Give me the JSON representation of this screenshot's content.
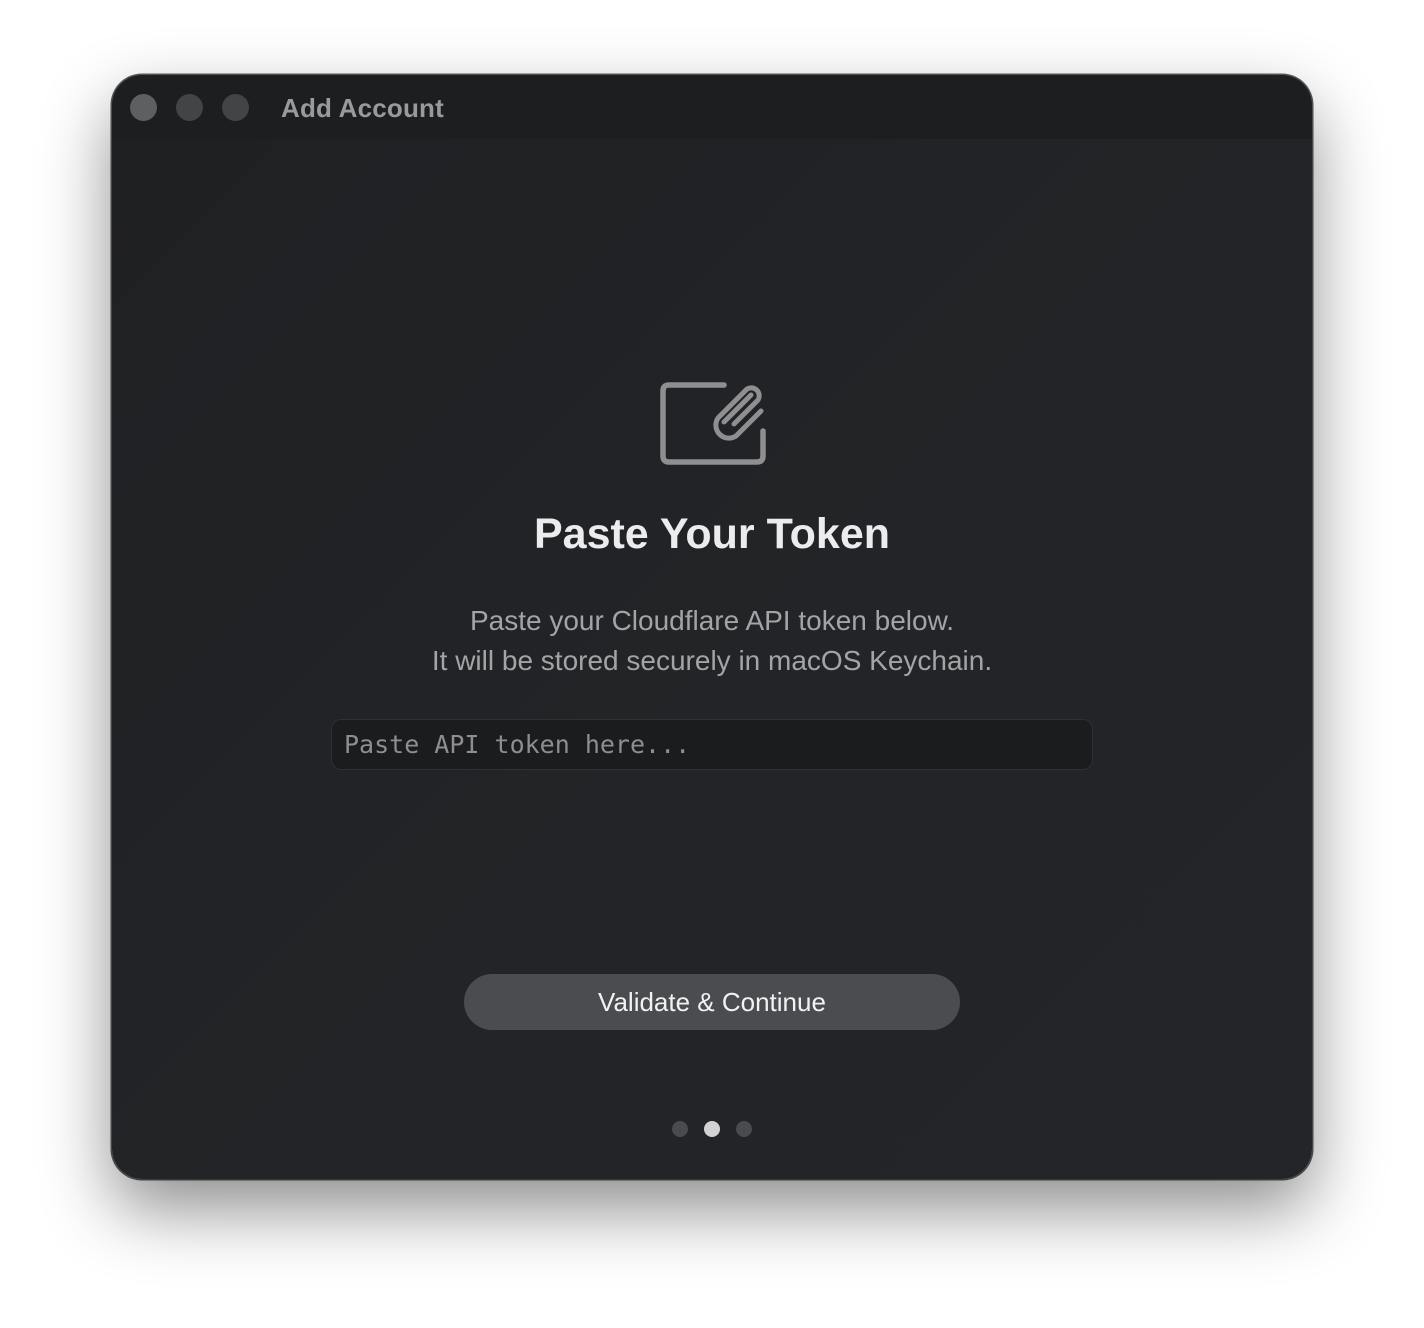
{
  "window": {
    "title": "Add Account"
  },
  "traffic_lights": [
    "close",
    "minimize",
    "zoom"
  ],
  "hero": {
    "icon": "paste-clipboard-paperclip-icon",
    "heading": "Paste Your Token",
    "description_line1": "Paste your Cloudflare API token below.",
    "description_line2": "It will be stored securely in macOS Keychain."
  },
  "token_field": {
    "value": "",
    "placeholder": "Paste API token here..."
  },
  "actions": {
    "primary_label": "Validate & Continue"
  },
  "pagination": {
    "total_steps": 3,
    "current_step": 2
  },
  "colors": {
    "window_bg": "#222427",
    "titlebar_bg": "#1d1e20",
    "button_bg": "#4b4c4f",
    "heading_text": "#ececee",
    "secondary_text": "#a4a4a7",
    "active_dot": "#d2d2d4",
    "inactive_dot": "#4a4b4e"
  }
}
